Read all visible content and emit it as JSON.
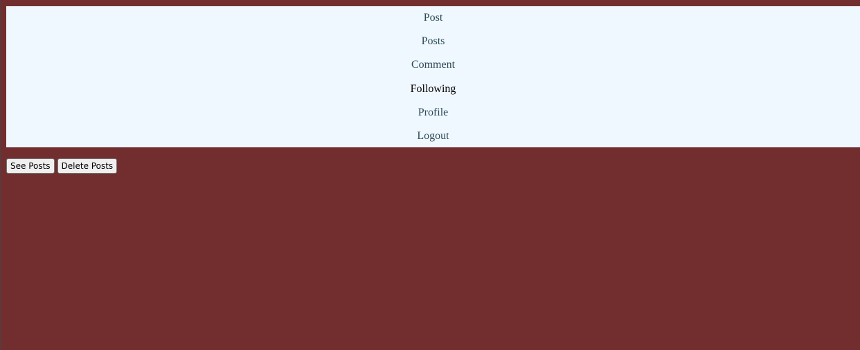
{
  "nav": {
    "items": [
      {
        "label": "Post"
      },
      {
        "label": "Posts"
      },
      {
        "label": "Comment"
      },
      {
        "label": "Following"
      },
      {
        "label": "Profile"
      },
      {
        "label": "Logout"
      }
    ],
    "active_label": "Following"
  },
  "actions": {
    "see_posts_label": "See Posts",
    "delete_posts_label": "Delete Posts"
  },
  "colors": {
    "page_background": "#722e2f",
    "nav_background": "#eff7ff",
    "nav_link": "#2b4a55",
    "nav_active_link": "#000000"
  }
}
